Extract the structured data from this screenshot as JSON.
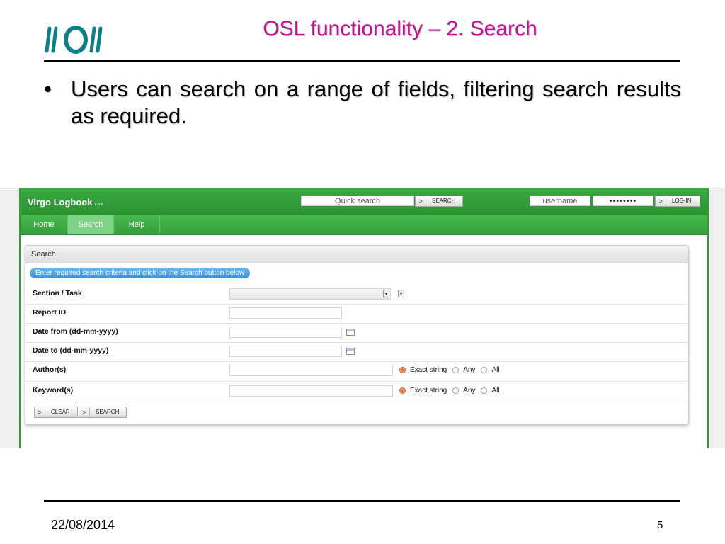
{
  "slide": {
    "title": "OSL functionality – 2. Search",
    "bullet": "Users can search on a range of fields, filtering search results as required.",
    "bullet_marker": "•",
    "footer_date": "22/08/2014",
    "page_number": "5"
  },
  "app": {
    "brand": "Virgo Logbook",
    "version": "v2r4",
    "quick_search_placeholder": "Quick search",
    "search_button": "SEARCH",
    "username_placeholder": "username",
    "password_mask": "••••••••",
    "login_button": "LOG-IN",
    "chevron": ">",
    "nav": [
      {
        "label": "Home",
        "active": false
      },
      {
        "label": "Search",
        "active": true
      },
      {
        "label": "Help",
        "active": false
      }
    ],
    "colors": {
      "header_green": "#3aa942",
      "nav_active": "#7fd185",
      "hint_blue": "#3a8fd6",
      "title_magenta": "#c0138f"
    }
  },
  "search_panel": {
    "title": "Search",
    "hint": "Enter required search criteria and click on the Search button below",
    "fields": {
      "section_task": "Section / Task",
      "report_id": "Report ID",
      "date_from": "Date from (dd-mm-yyyy)",
      "date_to": "Date to (dd-mm-yyyy)",
      "authors": "Author(s)",
      "keywords": "Keyword(s)"
    },
    "match_options": [
      "Exact string",
      "Any",
      "All"
    ],
    "selected_match": "Exact string",
    "clear_button": "CLEAR",
    "search_button": "SEARCH"
  }
}
